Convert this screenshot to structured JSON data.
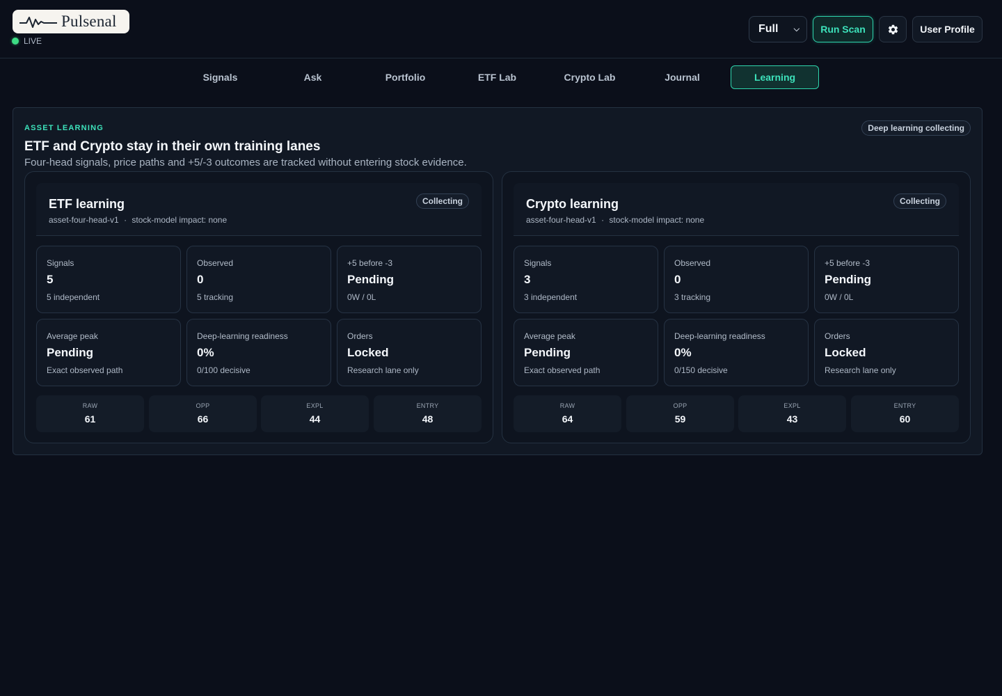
{
  "brand": {
    "name": "Pulsenal",
    "status": "LIVE",
    "status_color": "#3ddc84"
  },
  "toolbar": {
    "mode_value": "Full",
    "run_scan_label": "Run Scan",
    "settings_icon": "gear-icon",
    "profile_label": "User Profile",
    "accent_color": "#2fd6ae"
  },
  "nav": {
    "tabs": [
      {
        "label": "Signals"
      },
      {
        "label": "Ask"
      },
      {
        "label": "Portfolio"
      },
      {
        "label": "ETF Lab"
      },
      {
        "label": "Crypto Lab"
      },
      {
        "label": "Journal"
      },
      {
        "label": "Learning"
      }
    ],
    "active": "Learning"
  },
  "panel": {
    "eyebrow": "ASSET LEARNING",
    "title": "ETF and Crypto stay in their own training lanes",
    "subtitle": "Four-head signals, price paths and +5/-3 outcomes are tracked without entering stock evidence.",
    "badge": "Deep learning collecting"
  },
  "lanes": [
    {
      "title": "ETF learning",
      "badge": "Collecting",
      "model": "asset-four-head-v1",
      "separator": "·",
      "impact": "stock-model impact: none",
      "stats": [
        {
          "label": "Signals",
          "value": "5",
          "note": "5 independent"
        },
        {
          "label": "Observed",
          "value": "0",
          "note": "5 tracking"
        },
        {
          "label": "+5 before -3",
          "value": "Pending",
          "note": "0W / 0L"
        },
        {
          "label": "Average peak",
          "value": "Pending",
          "note": "Exact observed path"
        },
        {
          "label": "Deep-learning readiness",
          "value": "0%",
          "note": "0/100 decisive"
        },
        {
          "label": "Orders",
          "value": "Locked",
          "note": "Research lane only"
        }
      ],
      "scores": [
        {
          "label": "RAW",
          "value": "61"
        },
        {
          "label": "OPP",
          "value": "66"
        },
        {
          "label": "EXPL",
          "value": "44"
        },
        {
          "label": "ENTRY",
          "value": "48"
        }
      ]
    },
    {
      "title": "Crypto learning",
      "badge": "Collecting",
      "model": "asset-four-head-v1",
      "separator": "·",
      "impact": "stock-model impact: none",
      "stats": [
        {
          "label": "Signals",
          "value": "3",
          "note": "3 independent"
        },
        {
          "label": "Observed",
          "value": "0",
          "note": "3 tracking"
        },
        {
          "label": "+5 before -3",
          "value": "Pending",
          "note": "0W / 0L"
        },
        {
          "label": "Average peak",
          "value": "Pending",
          "note": "Exact observed path"
        },
        {
          "label": "Deep-learning readiness",
          "value": "0%",
          "note": "0/150 decisive"
        },
        {
          "label": "Orders",
          "value": "Locked",
          "note": "Research lane only"
        }
      ],
      "scores": [
        {
          "label": "RAW",
          "value": "64"
        },
        {
          "label": "OPP",
          "value": "59"
        },
        {
          "label": "EXPL",
          "value": "43"
        },
        {
          "label": "ENTRY",
          "value": "60"
        }
      ]
    }
  ]
}
